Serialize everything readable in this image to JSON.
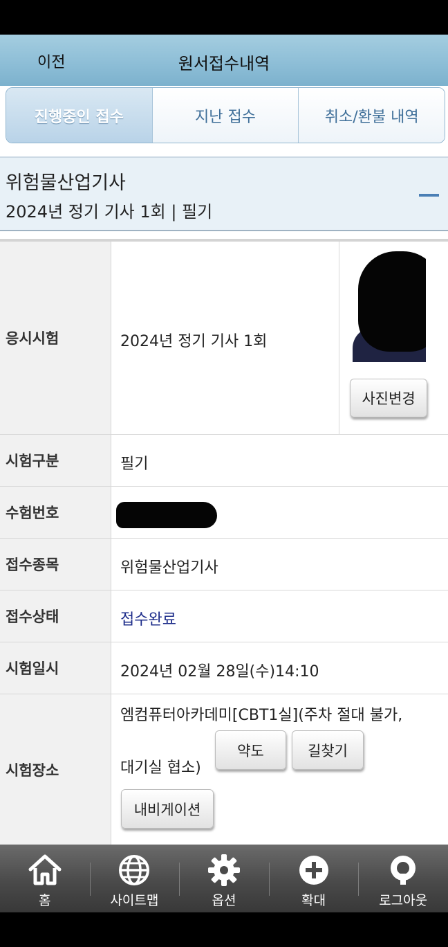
{
  "header": {
    "back_label": "이전",
    "title": "원서접수내역"
  },
  "tabs": [
    {
      "label": "진행중인 접수",
      "active": true
    },
    {
      "label": "지난 접수",
      "active": false
    },
    {
      "label": "취소/환불 내역",
      "active": false
    }
  ],
  "section": {
    "name": "위험물산업기사",
    "subtitle": "2024년 정기 기사 1회 | 필기"
  },
  "details": {
    "exam": {
      "label": "응시시험",
      "value": "2024년 정기 기사 1회"
    },
    "photo_button": "사진변경",
    "category": {
      "label": "시험구분",
      "value": "필기"
    },
    "exam_number": {
      "label": "수험번호",
      "value": ""
    },
    "item": {
      "label": "접수종목",
      "value": "위험물산업기사"
    },
    "status": {
      "label": "접수상태",
      "value": "접수완료"
    },
    "datetime": {
      "label": "시험일시",
      "value": "2024년 02월 28일(수)14:10"
    },
    "place": {
      "label": "시험장소",
      "line1": "엠컴퓨터아카데미[CBT1실](주차 절대 불가,",
      "line2": "대기실 협소)",
      "map_button": "약도",
      "directions_button": "길찾기",
      "navigation_button": "내비게이션"
    }
  },
  "bottom_nav": [
    {
      "label": "홈",
      "icon": "home-icon"
    },
    {
      "label": "사이트맵",
      "icon": "globe-icon"
    },
    {
      "label": "옵션",
      "icon": "gear-icon"
    },
    {
      "label": "확대",
      "icon": "plus-circle-icon"
    },
    {
      "label": "로그아웃",
      "icon": "logout-icon"
    }
  ],
  "colors": {
    "header": "#8cbdd6",
    "status_link": "#1c2c8a",
    "accent": "#4a7fb5"
  }
}
